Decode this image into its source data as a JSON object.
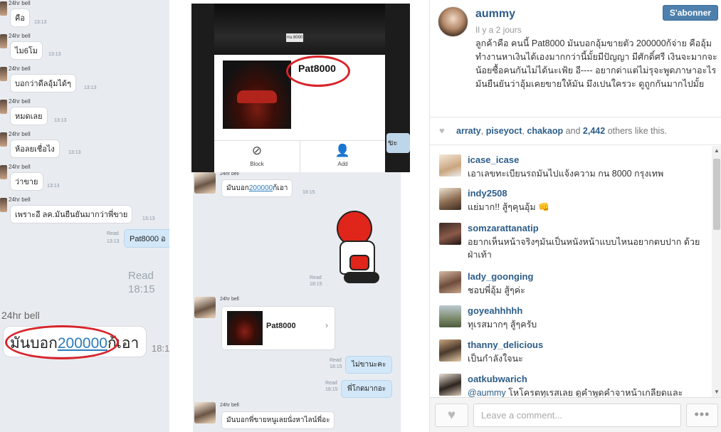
{
  "photo": {
    "chat_left": {
      "sender": "24hr bell",
      "messages": [
        {
          "text": "คือ",
          "time": "13:13"
        },
        {
          "text": "ไม6โม",
          "time": "13:13"
        },
        {
          "text": "บอกว่าดีลอุ้มได้ๆ",
          "time": "13:13"
        },
        {
          "text": "หมดเลย",
          "time": "13:13"
        },
        {
          "text": "ห้อลยเชื่อไง",
          "time": "13:13"
        },
        {
          "text": "ว่าขาย",
          "time": "13:13"
        },
        {
          "text": "เพราะอี ลค.มันยืนยันมากว่าพี่ขาย",
          "time": "13:13"
        }
      ],
      "sent_text": "Pat8000 อ",
      "sent_read": "Read",
      "sent_time": "13:13",
      "read_big": "Read",
      "read_big_time": "18:15",
      "big_sender": "24hr bell",
      "big_msg_prefix": "มันบอก",
      "big_msg_link": "200000",
      "big_msg_suffix": "ก้เอา",
      "big_msg_time": "18:1"
    },
    "profile": {
      "plate": "กน 8000",
      "name": "Pat8000",
      "block_label": "Block",
      "add_label": "Add",
      "side_text": "ขะ"
    },
    "chat_mid": {
      "sender": "24hr bell",
      "msg1_prefix": "มันบอก",
      "msg1_link": "200000",
      "msg1_suffix": "ก้เอา",
      "msg1_time": "18:15",
      "sticker_read": "Read",
      "sticker_time": "18:15",
      "card_name": "Pat8000",
      "card_chevron": "›",
      "sent1": "ไม่ขานะคะ",
      "sent1_read": "Read",
      "sent1_time": "18:15",
      "sent2": "พี่โกดมากอะ",
      "sent2_read": "Read",
      "sent2_time": "18:15",
      "msg2": "มันบอกพี่ขายหนูเลยนั่งหาไลน์พี่อะ"
    }
  },
  "sidebar": {
    "username": "aummy",
    "timestamp": "Il y a 2 jours",
    "follow_label": "S'abonner",
    "caption": "ลูกค้าคือ คนนี้ Pat8000 มันบอกอุ้มขายตัว 200000ก้จ่าย คืออุ้มทำงานหาเงินได้เองมากกว่านี้มั้ยมีปัญญา มีศักดิ์ศรี เงินจะมากจะน้อยซื้อคนกันไม่ได้นะเฟ้ย อี---- อยากด่าแต่ไม่รุจะพูดภาษาอะไร มันยืนยันว่าอุ้มเคยขายให้มัน มึงเปนใครวะ ดูถูกกันมากไปมั้ย",
    "likes": {
      "users": [
        "arraty",
        "piseyoct",
        "chakaop"
      ],
      "and": "and",
      "count": "2,442",
      "suffix": "others like this."
    },
    "comments": [
      {
        "user": "icase_icase",
        "text": "เอาเลขทะเบียนรถมันไปแจ้งความ กน 8000 กรุงเทพ"
      },
      {
        "user": "indy2508",
        "text": "แย่มาก!! สู้ๆคุนอุ้ม 👊"
      },
      {
        "user": "somzarattanatip",
        "text": "อยากเห็นหน้าจริงๆมันเป็นหนังหน้าแบบไหนอยากตบปาก ด้วยฝ่าเท้า"
      },
      {
        "user": "lady_goonging",
        "text": "ชอบพี่อุ้ม สู้ๆค่ะ"
      },
      {
        "user": "goyeahhhhh",
        "text": "ทุเรสมากๆ สู้ๆครับ"
      },
      {
        "user": "thanny_delicious",
        "text": "เป็นกำลังใจนะ"
      },
      {
        "user": "oatkubwarich",
        "mention": "@aummy",
        "text": " โหโครตทุเรสเลย ดูคำพูดคำจาหน้าเกลียดและ"
      }
    ],
    "comment_placeholder": "Leave a comment...",
    "more_label": "•••",
    "colors": {
      "link": "#2c5d89",
      "follow_bg": "#4d80ad",
      "oval": "#d7242a"
    }
  }
}
